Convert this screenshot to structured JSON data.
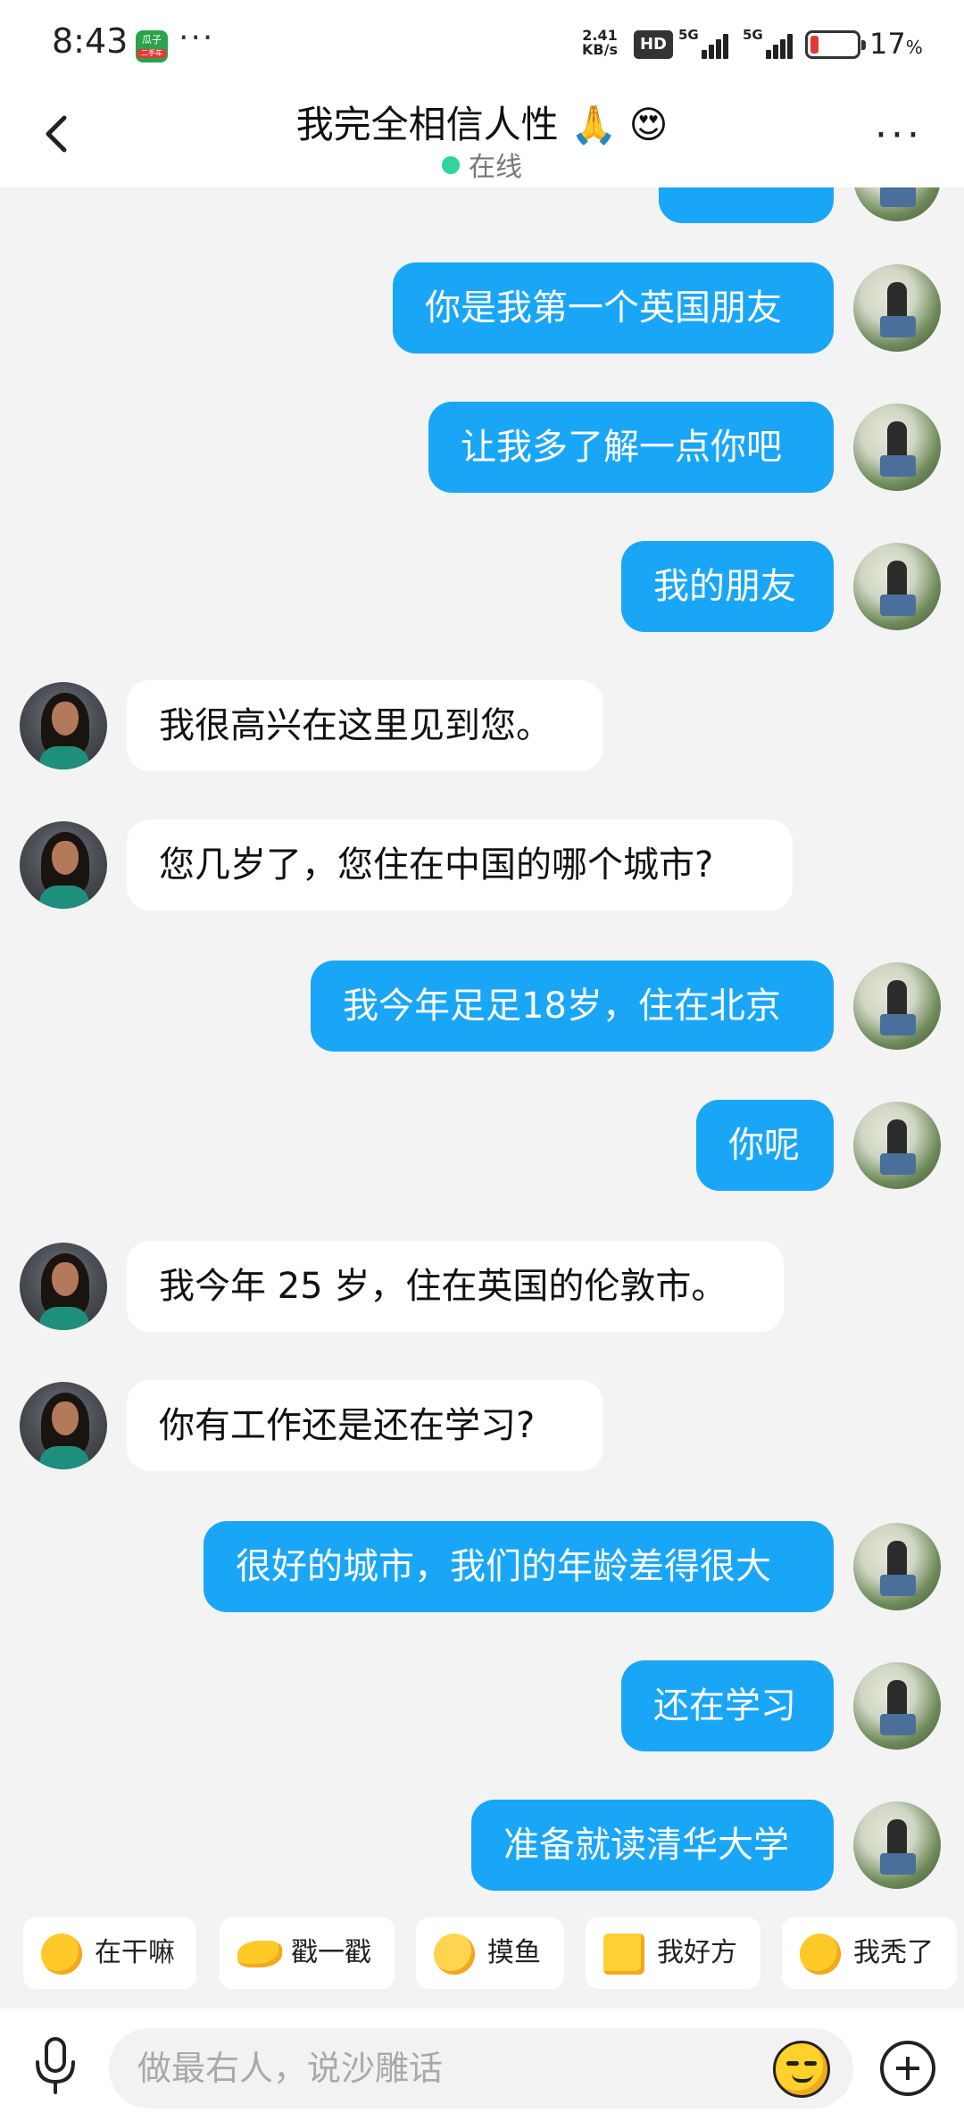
{
  "status_bar": {
    "time": "8:43",
    "app_badge": "瓜子",
    "app_badge_sub": "二手车",
    "dots": "···",
    "net_speed_value": "2.41",
    "net_speed_unit": "KB/s",
    "hd_label": "HD",
    "signal1_label": "5G",
    "signal2_label": "5G",
    "battery_pct": "17",
    "battery_unit": "%",
    "battery_level": 0.17,
    "battery_color": "#e53935"
  },
  "header": {
    "back_icon": "chevron-left-icon",
    "title": "我完全相信人性 🙏 😍",
    "status_text": "在线",
    "status_color": "#2fd59a",
    "more_icon": "more-horizontal-icon"
  },
  "chat": {
    "outgoing_color": "#1aa6f7",
    "incoming_color": "#ffffff",
    "messages": [
      {
        "side": "out",
        "text": ""
      },
      {
        "side": "out",
        "text": "你是我第一个英国朋友"
      },
      {
        "side": "out",
        "text": "让我多了解一点你吧"
      },
      {
        "side": "out",
        "text": "我的朋友"
      },
      {
        "side": "in",
        "text": "我很高兴在这里见到您。"
      },
      {
        "side": "in",
        "text": "您几岁了，您住在中国的哪个城市?"
      },
      {
        "side": "out",
        "text": "我今年足足18岁，住在北京"
      },
      {
        "side": "out",
        "text": "你呢"
      },
      {
        "side": "in",
        "text": "我今年 25 岁，住在英国的伦敦市。"
      },
      {
        "side": "in",
        "text": "你有工作还是还在学习?"
      },
      {
        "side": "out",
        "text": "很好的城市，我们的年龄差得很大"
      },
      {
        "side": "out",
        "text": "还在学习"
      },
      {
        "side": "out",
        "text": "准备就读清华大学"
      }
    ]
  },
  "quick_replies": [
    {
      "label": "在干嘛",
      "icon": "busy-face-icon"
    },
    {
      "label": "戳一戳",
      "icon": "poke-hand-icon"
    },
    {
      "label": "摸鱼",
      "icon": "slacking-face-icon"
    },
    {
      "label": "我好方",
      "icon": "square-face-icon"
    },
    {
      "label": "我秃了",
      "icon": "bald-face-icon"
    }
  ],
  "input_bar": {
    "mic_icon": "microphone-icon",
    "placeholder": "做最右人，说沙雕话",
    "emoji_icon": "smiley-icon",
    "plus_icon": "plus-circle-icon"
  }
}
